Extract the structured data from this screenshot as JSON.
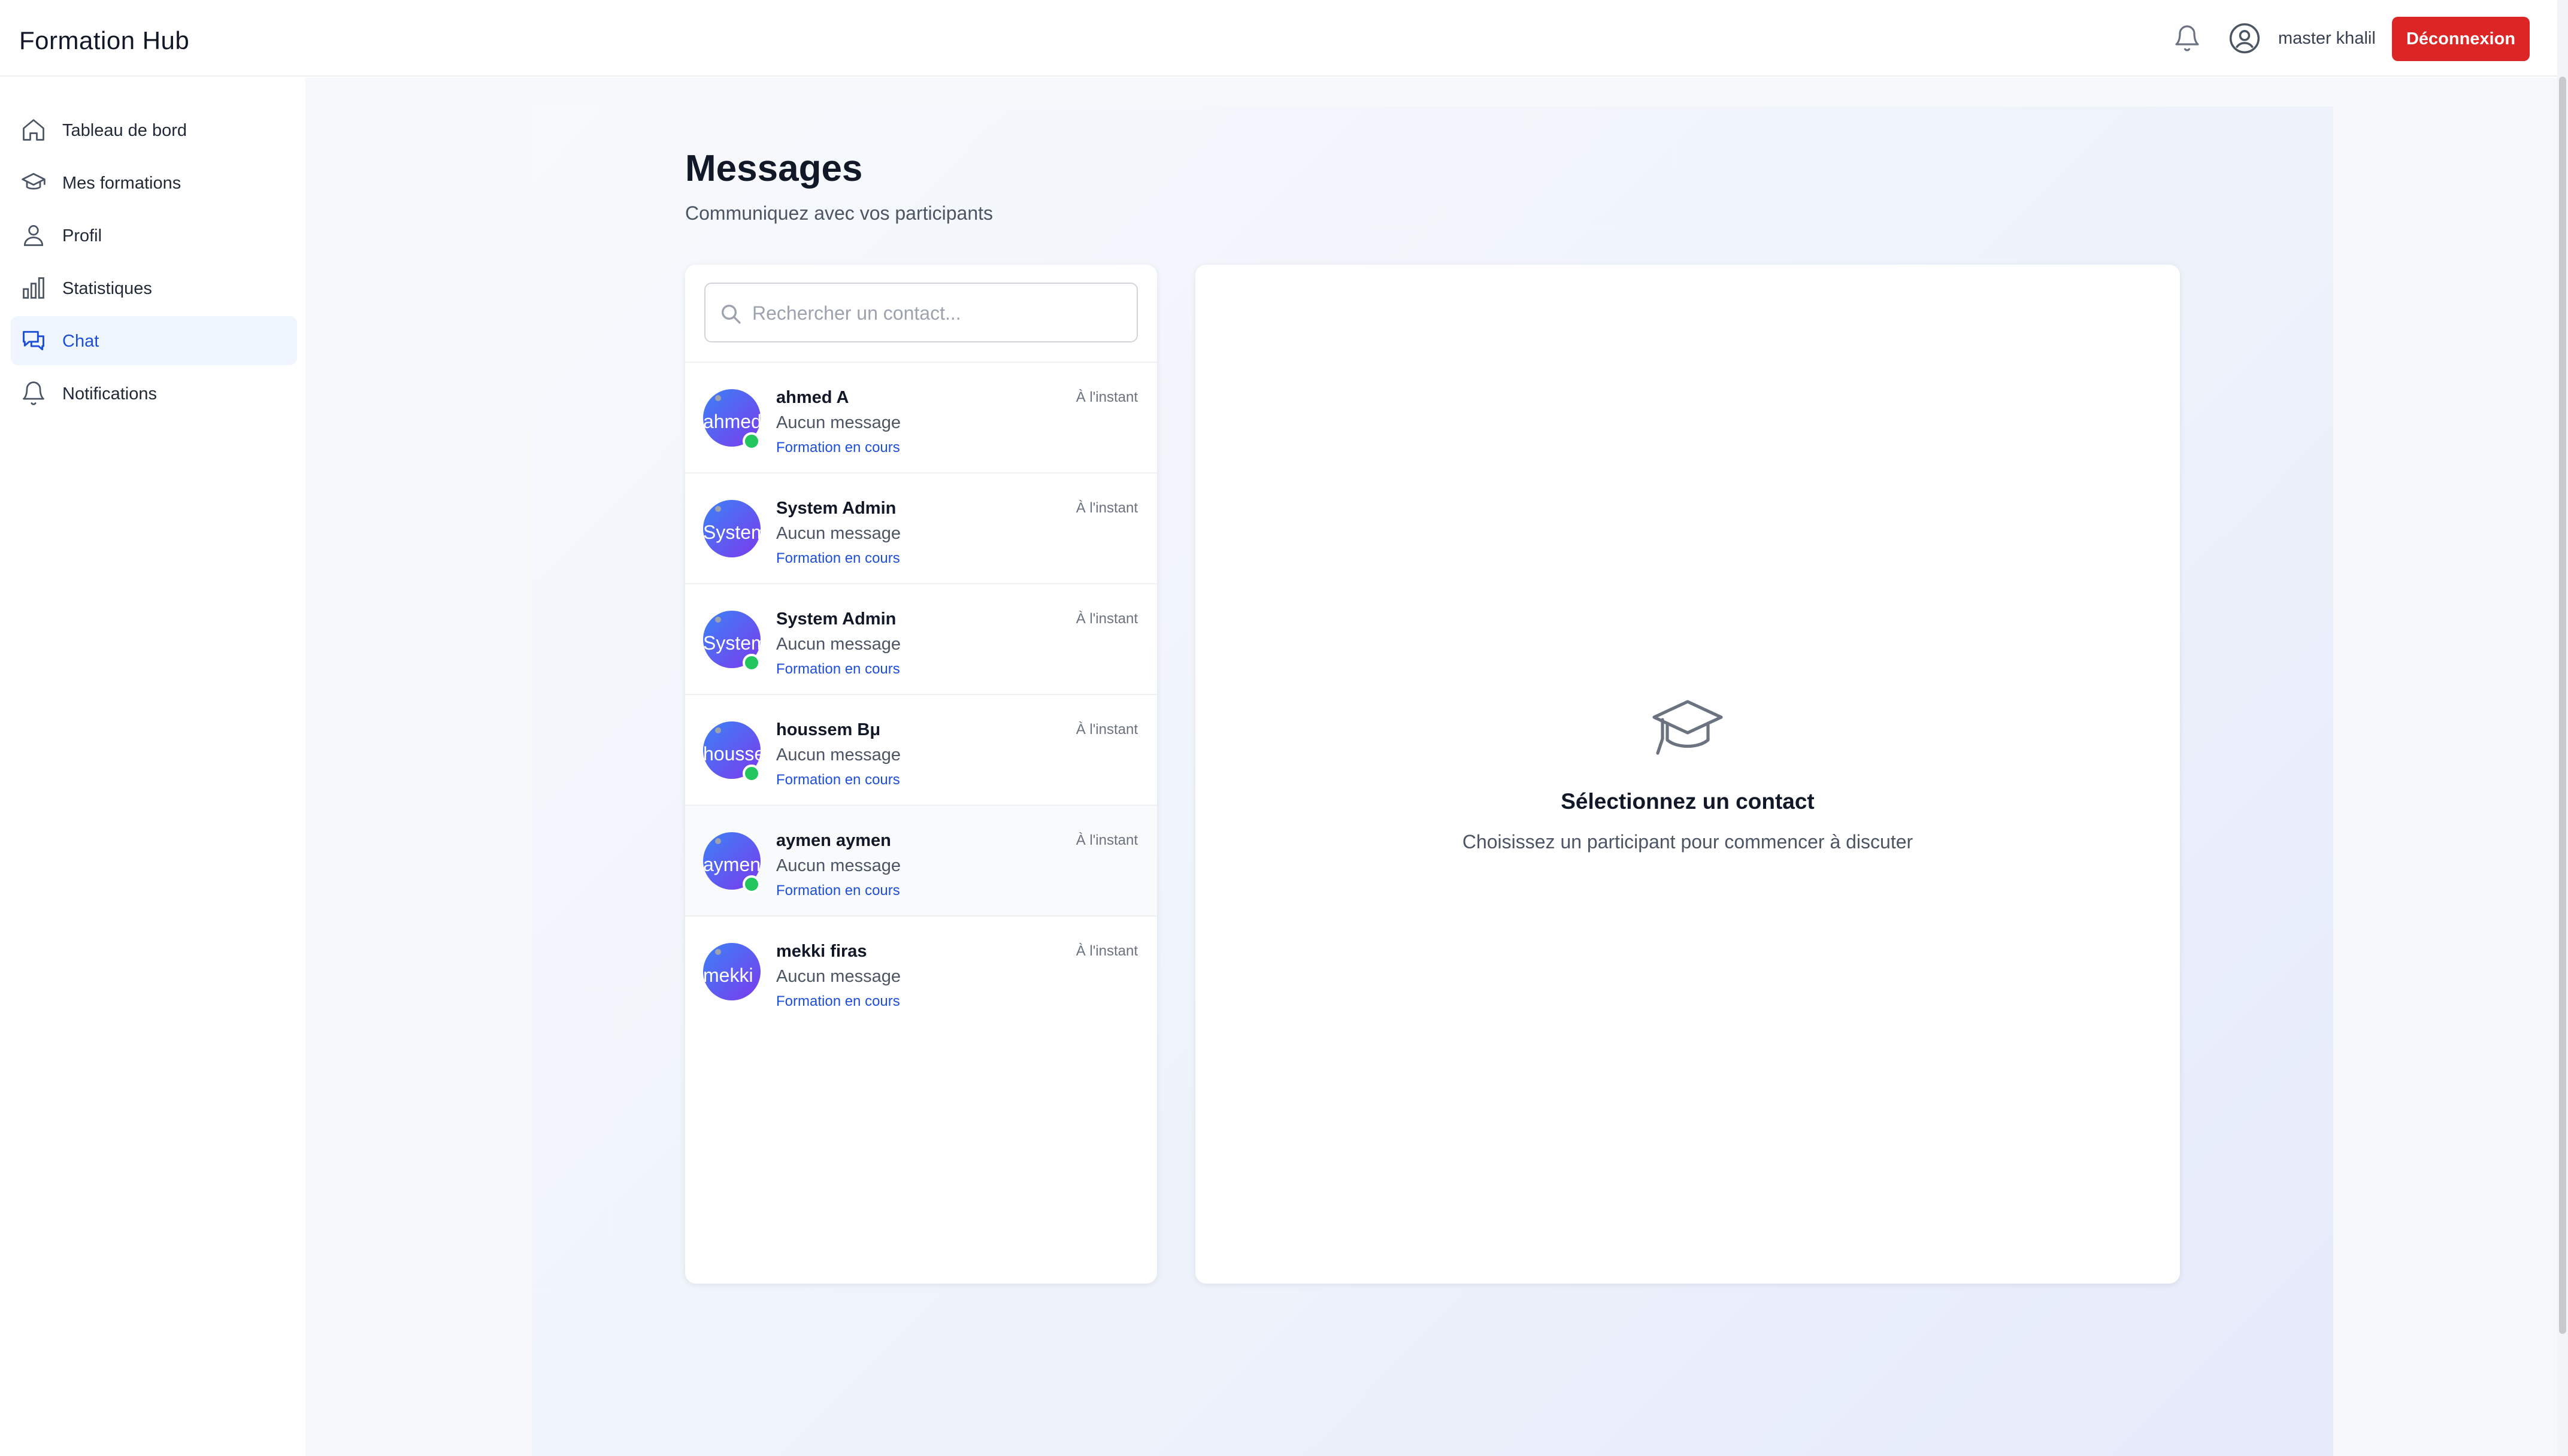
{
  "app": {
    "brand": "Formation Hub"
  },
  "header": {
    "user_name": "master khalil",
    "logout_label": "Déconnexion"
  },
  "sidebar": {
    "items": [
      {
        "label": "Tableau de bord",
        "icon": "home-icon"
      },
      {
        "label": "Mes formations",
        "icon": "graduation-cap-icon"
      },
      {
        "label": "Profil",
        "icon": "user-icon"
      },
      {
        "label": "Statistiques",
        "icon": "bar-chart-icon"
      },
      {
        "label": "Chat",
        "icon": "chat-icon",
        "active": true
      },
      {
        "label": "Notifications",
        "icon": "bell-icon"
      }
    ]
  },
  "page": {
    "title": "Messages",
    "subtitle": "Communiquez avec vos participants"
  },
  "search": {
    "placeholder": "Rechercher un contact..."
  },
  "contacts": [
    {
      "name": "ahmed A",
      "avatar_text": "ahmed",
      "time": "À l'instant",
      "last_message": "Aucun message",
      "status": "Formation en cours",
      "online": true
    },
    {
      "name": "System Admin",
      "avatar_text": "System",
      "time": "À l'instant",
      "last_message": "Aucun message",
      "status": "Formation en cours",
      "online": false
    },
    {
      "name": "System Admin",
      "avatar_text": "System",
      "time": "À l'instant",
      "last_message": "Aucun message",
      "status": "Formation en cours",
      "online": true
    },
    {
      "name": "houssem Bμ",
      "avatar_text": "houssem",
      "time": "À l'instant",
      "last_message": "Aucun message",
      "status": "Formation en cours",
      "online": true
    },
    {
      "name": "aymen aymen",
      "avatar_text": "aymen",
      "time": "À l'instant",
      "last_message": "Aucun message",
      "status": "Formation en cours",
      "online": true
    },
    {
      "name": "mekki firas",
      "avatar_text": "mekki",
      "time": "À l'instant",
      "last_message": "Aucun message",
      "status": "Formation en cours",
      "online": false
    }
  ],
  "empty_state": {
    "icon": "graduation-cap-icon",
    "title": "Sélectionnez un contact",
    "subtitle": "Choisissez un participant pour commencer à discuter"
  },
  "colors": {
    "accent": "#1d4ed8",
    "danger": "#dc2626",
    "online": "#22c55e",
    "avatar_gradient_start": "#3b82f6",
    "avatar_gradient_end": "#7c3aed"
  }
}
